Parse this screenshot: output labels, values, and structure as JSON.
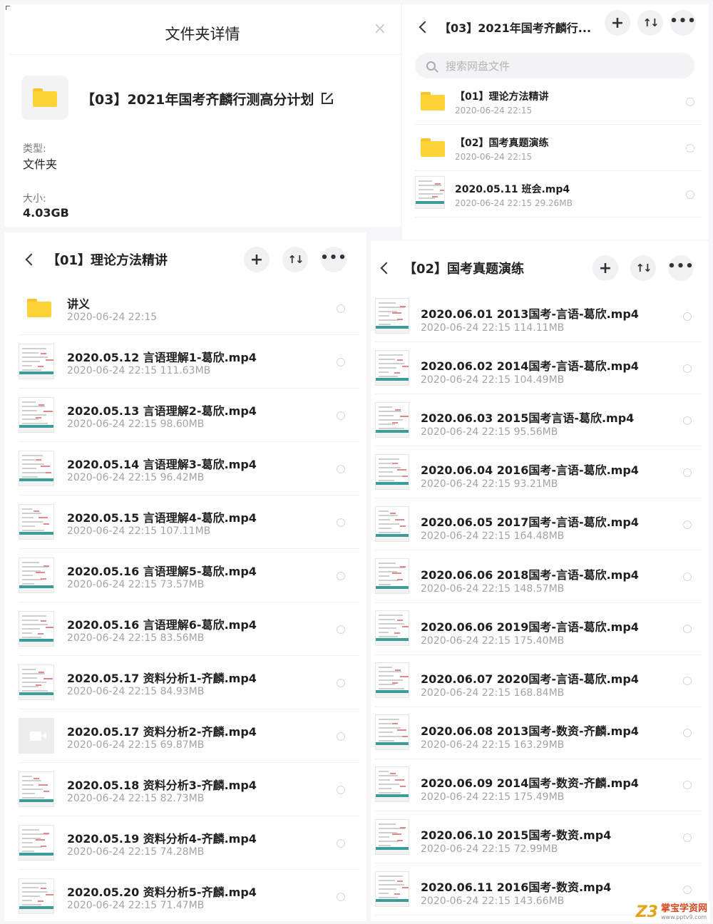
{
  "details": {
    "title": "文件夹详情",
    "close_symbol": "×",
    "folder_name": "【03】2021年国考齐麟行测高分计划",
    "type_label": "类型:",
    "type_value": "文件夹",
    "size_label": "大小:",
    "size_value": "4.03GB"
  },
  "icons": {
    "back": "chevron-left-icon",
    "add": "plus-icon",
    "sort": "sort-icon",
    "more": "more-icon",
    "folder": "folder-icon",
    "edit": "edit-icon",
    "search": "search-icon",
    "close": "close-icon"
  },
  "colors": {
    "folder": "#fdd338",
    "accent_thumb_bar": "#3c9c9a",
    "watermark_orange": "#e6a21a",
    "watermark_red": "#d4481e"
  },
  "buttons": {
    "plus": "+",
    "sort": "↑↓",
    "more": "•••"
  },
  "top_right": {
    "title": "【03】2021年国考齐麟行...",
    "search_placeholder": "搜索网盘文件",
    "items": [
      {
        "kind": "folder",
        "name": "【01】理论方法精讲",
        "meta": "2020-06-24  22:15"
      },
      {
        "kind": "folder",
        "name": "【02】国考真题演练",
        "meta": "2020-06-24  22:15"
      },
      {
        "kind": "thumb",
        "name": "2020.05.11 班会.mp4",
        "meta": "2020-06-24  22:15  29.26MB"
      }
    ]
  },
  "theory": {
    "title": "【01】理论方法精讲",
    "items": [
      {
        "kind": "folder",
        "name": "讲义",
        "meta": "2020-06-24  22:15"
      },
      {
        "kind": "thumb",
        "name": "2020.05.12 言语理解1-葛欣.mp4",
        "meta": "2020-06-24  22:15  111.63MB"
      },
      {
        "kind": "thumb",
        "name": "2020.05.13 言语理解2-葛欣.mp4",
        "meta": "2020-06-24  22:15  98.60MB"
      },
      {
        "kind": "thumb",
        "name": "2020.05.14 言语理解3-葛欣.mp4",
        "meta": "2020-06-24  22:15  96.42MB"
      },
      {
        "kind": "thumb",
        "name": "2020.05.15 言语理解4-葛欣.mp4",
        "meta": "2020-06-24  22:15  107.11MB"
      },
      {
        "kind": "thumb",
        "name": "2020.05.16 言语理解5-葛欣.mp4",
        "meta": "2020-06-24  22:15  73.57MB"
      },
      {
        "kind": "thumb",
        "name": "2020.05.16 言语理解6-葛欣.mp4",
        "meta": "2020-06-24  22:15  83.56MB"
      },
      {
        "kind": "thumb",
        "name": "2020.05.17 资料分析1-齐麟.mp4",
        "meta": "2020-06-24  22:15  84.93MB"
      },
      {
        "kind": "video",
        "name": "2020.05.17 资料分析2-齐麟.mp4",
        "meta": "2020-06-24  22:15  69.87MB"
      },
      {
        "kind": "thumb",
        "name": "2020.05.18 资料分析3-齐麟.mp4",
        "meta": "2020-06-24  22:15  82.73MB"
      },
      {
        "kind": "thumb",
        "name": "2020.05.19 资料分析4-齐麟.mp4",
        "meta": "2020-06-24  22:15  74.28MB"
      },
      {
        "kind": "thumb",
        "name": "2020.05.20 资料分析5-齐麟.mp4",
        "meta": "2020-06-24  22:15  71.47MB"
      }
    ]
  },
  "exam": {
    "title": "【02】国考真题演练",
    "items": [
      {
        "kind": "thumb",
        "name": "2020.06.01 2013国考-言语-葛欣.mp4",
        "meta": "2020-06-24  22:15  114.11MB"
      },
      {
        "kind": "thumb",
        "name": "2020.06.02 2014国考-言语-葛欣.mp4",
        "meta": "2020-06-24  22:15  104.49MB"
      },
      {
        "kind": "thumb",
        "name": "2020.06.03 2015国考言语-葛欣.mp4",
        "meta": "2020-06-24  22:15  95.56MB"
      },
      {
        "kind": "thumb",
        "name": "2020.06.04 2016国考-言语-葛欣.mp4",
        "meta": "2020-06-24  22:15  93.21MB"
      },
      {
        "kind": "thumb",
        "name": "2020.06.05 2017国考-言语-葛欣.mp4",
        "meta": "2020-06-24  22:15  164.48MB"
      },
      {
        "kind": "thumb",
        "name": "2020.06.06 2018国考-言语-葛欣.mp4",
        "meta": "2020-06-24  22:15  148.57MB"
      },
      {
        "kind": "thumb",
        "name": "2020.06.06 2019国考-言语-葛欣.mp4",
        "meta": "2020-06-24  22:15  175.40MB"
      },
      {
        "kind": "thumb",
        "name": "2020.06.07 2020国考-言语-葛欣.mp4",
        "meta": "2020-06-24  22:15  168.84MB"
      },
      {
        "kind": "thumb",
        "name": "2020.06.08 2013国考-数资-齐麟.mp4",
        "meta": "2020-06-24  22:15  163.29MB"
      },
      {
        "kind": "thumb",
        "name": "2020.06.09 2014国考-数资-齐麟.mp4",
        "meta": "2020-06-24  22:15  175.49MB"
      },
      {
        "kind": "thumb",
        "name": "2020.06.10 2015国考-数资.mp4",
        "meta": "2020-06-24  22:15  72.99MB"
      },
      {
        "kind": "thumb",
        "name": "2020.06.11 2016国考-数资.mp4",
        "meta": "2020-06-24  22:15  143.66MB"
      }
    ]
  },
  "watermark": {
    "logo": "Z3",
    "name": "掌宝学资网",
    "url": "www.pptv9.com"
  }
}
